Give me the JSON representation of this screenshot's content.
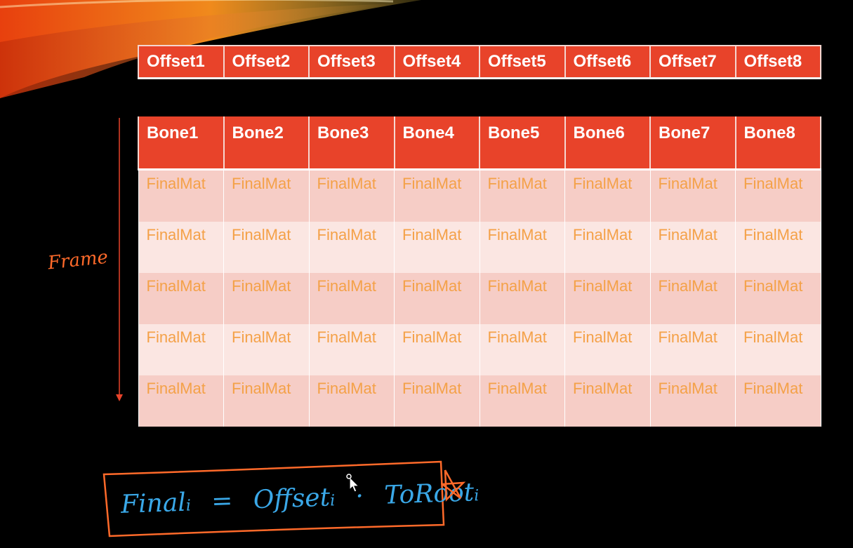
{
  "offsets": [
    "Offset1",
    "Offset2",
    "Offset3",
    "Offset4",
    "Offset5",
    "Offset6",
    "Offset7",
    "Offset8"
  ],
  "bones": [
    "Bone1",
    "Bone2",
    "Bone3",
    "Bone4",
    "Bone5",
    "Bone6",
    "Bone7",
    "Bone8"
  ],
  "rows": [
    [
      "FinalMat",
      "FinalMat",
      "FinalMat",
      "FinalMat",
      "FinalMat",
      "FinalMat",
      "FinalMat",
      "FinalMat"
    ],
    [
      "FinalMat",
      "FinalMat",
      "FinalMat",
      "FinalMat",
      "FinalMat",
      "FinalMat",
      "FinalMat",
      "FinalMat"
    ],
    [
      "FinalMat",
      "FinalMat",
      "FinalMat",
      "FinalMat",
      "FinalMat",
      "FinalMat",
      "FinalMat",
      "FinalMat"
    ],
    [
      "FinalMat",
      "FinalMat",
      "FinalMat",
      "FinalMat",
      "FinalMat",
      "FinalMat",
      "FinalMat",
      "FinalMat"
    ],
    [
      "FinalMat",
      "FinalMat",
      "FinalMat",
      "FinalMat",
      "FinalMat",
      "FinalMat",
      "FinalMat",
      "FinalMat"
    ]
  ],
  "frame_label": "Frame",
  "formula": {
    "lhs": "Final",
    "lhs_sub": "i",
    "equals": "=",
    "term1": "Offset",
    "term1_sub": "i",
    "dot": "·",
    "term2": "ToRoot",
    "term2_sub": "i"
  },
  "colors": {
    "header_red": "#e8432a",
    "cell_text_orange": "#f4a148",
    "handwriting_orange": "#ff6a2a",
    "handwriting_blue": "#3aa8e8"
  },
  "icons": [
    "cursor-icon",
    "star-icon"
  ]
}
